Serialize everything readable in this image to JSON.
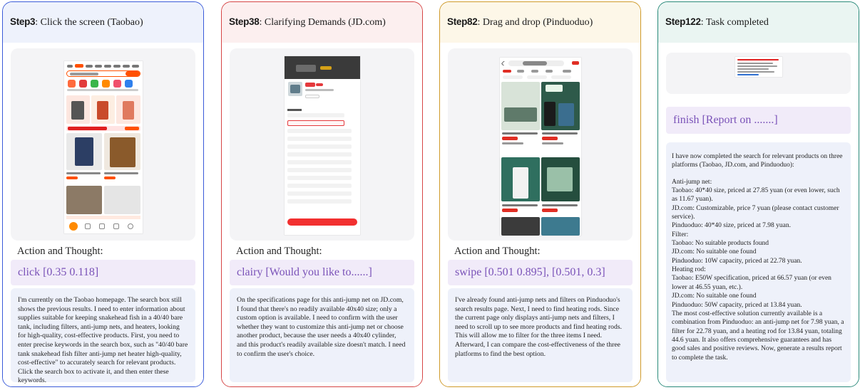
{
  "colors": {
    "panel1_border": "#3a5bd9",
    "panel1_head": "#eef2fc",
    "panel2_border": "#d64545",
    "panel2_head": "#fcefef",
    "panel3_border": "#cf9a2a",
    "panel3_head": "#fdf7e8",
    "panel4_border": "#2a8a7a",
    "panel4_head": "#eaf5f2",
    "action_text": "#7a52b8",
    "taobao_orange": "#ff5000",
    "jd_red": "#e4393c"
  },
  "common": {
    "action_thought_label": "Action and Thought:"
  },
  "panels": [
    {
      "step": "Step3",
      "title": ": Click the screen (Taobao)",
      "action": "click [0.35 0.118]",
      "thought": "I'm currently on the Taobao homepage. The search box still shows the previous results. I need to enter information about supplies suitable for keeping snakehead fish in a 40/40 bare tank, including filters, anti-jump nets, and heaters, looking for high-quality, cost-effective products. First, you need to enter precise keywords in the search box, such as \"40/40 bare tank snakehead fish filter anti-jump net heater high-quality, cost-effective\" to accurately search for relevant products. Click the search box to activate it, and then enter these keywords."
    },
    {
      "step": "Step38",
      "title": ": Clarifying Demands (JD.com)",
      "action": "clairy [Would you like to......]",
      "thought": "On the specifications page for this anti-jump net on JD.com, I found that there's no readily available 40x40 size; only a custom option is available. I need to confirm with the user whether they want to customize this anti-jump net or choose another product, because the user needs a 40x40 cylinder, and this product's readily available size doesn't match. I need to confirm the user's choice."
    },
    {
      "step": "Step82",
      "title": ": Drag and drop (Pinduoduo)",
      "action": "swipe [0.501 0.895], [0.501, 0.3]",
      "thought": "I've already found anti-jump nets and filters on Pinduoduo's search results page. Next, I need to find heating rods. Since the current page only displays anti-jump nets and filters, I need to scroll up to see more products and find heating rods. This will allow me to filter for the three items I need. Afterward, I can compare the cost-effectiveness of the three platforms to find the best option."
    },
    {
      "step": "Step122",
      "title": ": Task completed",
      "action": "finish [Report on .......]",
      "thought_lines": [
        "I have now completed the search for relevant products on three platforms (Taobao, JD.com, and Pinduoduo):",
        "",
        "Anti-jump net:",
        "Taobao: 40*40 size, priced at 27.85 yuan (or even lower, such as 11.67 yuan).",
        "JD.com: Customizable, price 7 yuan (please contact customer service).",
        "Pinduoduo: 40*40 size, priced at 7.98 yuan.",
        "Filter:",
        "Taobao: No suitable products found",
        "JD.com: No suitable one found",
        "Pinduoduo: 10W capacity, priced at 22.78 yuan.",
        "Heating rod:",
        "Taobao: E50W specification, priced at 66.57 yuan (or even lower at 46.55 yuan, etc.).",
        "JD.com: No suitable one found",
        "Pinduoduo: 50W capacity, priced at 13.84 yuan.",
        "The most cost-effective solution currently available is a combination from Pinduoduo: an anti-jump net for 7.98 yuan, a filter for 22.78 yuan, and a heating rod for 13.84 yuan, totaling 44.6 yuan. It also offers comprehensive guarantees and has good sales and positive reviews. Now, generate a results report to complete the task."
      ]
    }
  ]
}
